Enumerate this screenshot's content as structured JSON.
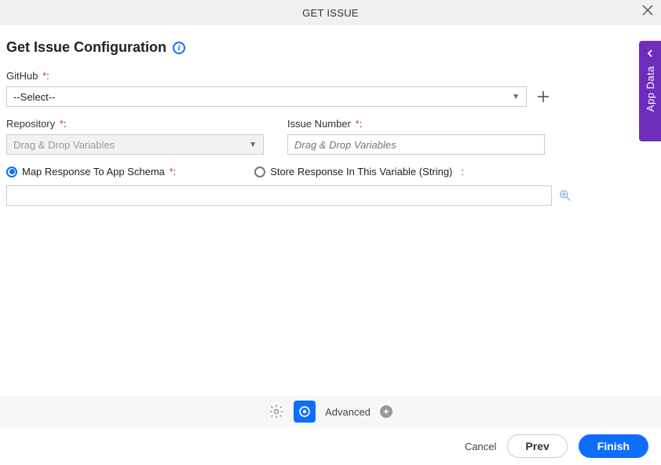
{
  "header": {
    "title": "GET ISSUE"
  },
  "page_title": "Get Issue Configuration",
  "fields": {
    "github": {
      "label": "GitHub",
      "value": "--Select--"
    },
    "repository": {
      "label": "Repository",
      "placeholder": "Drag & Drop Variables"
    },
    "issue_number": {
      "label": "Issue Number",
      "placeholder": "Drag & Drop Variables"
    }
  },
  "radios": {
    "map_schema": "Map Response To App Schema",
    "store_var": "Store Response In This Variable (String)"
  },
  "side_tab": "App Data",
  "toolbar": {
    "advanced": "Advanced"
  },
  "footer": {
    "cancel": "Cancel",
    "prev": "Prev",
    "finish": "Finish"
  }
}
